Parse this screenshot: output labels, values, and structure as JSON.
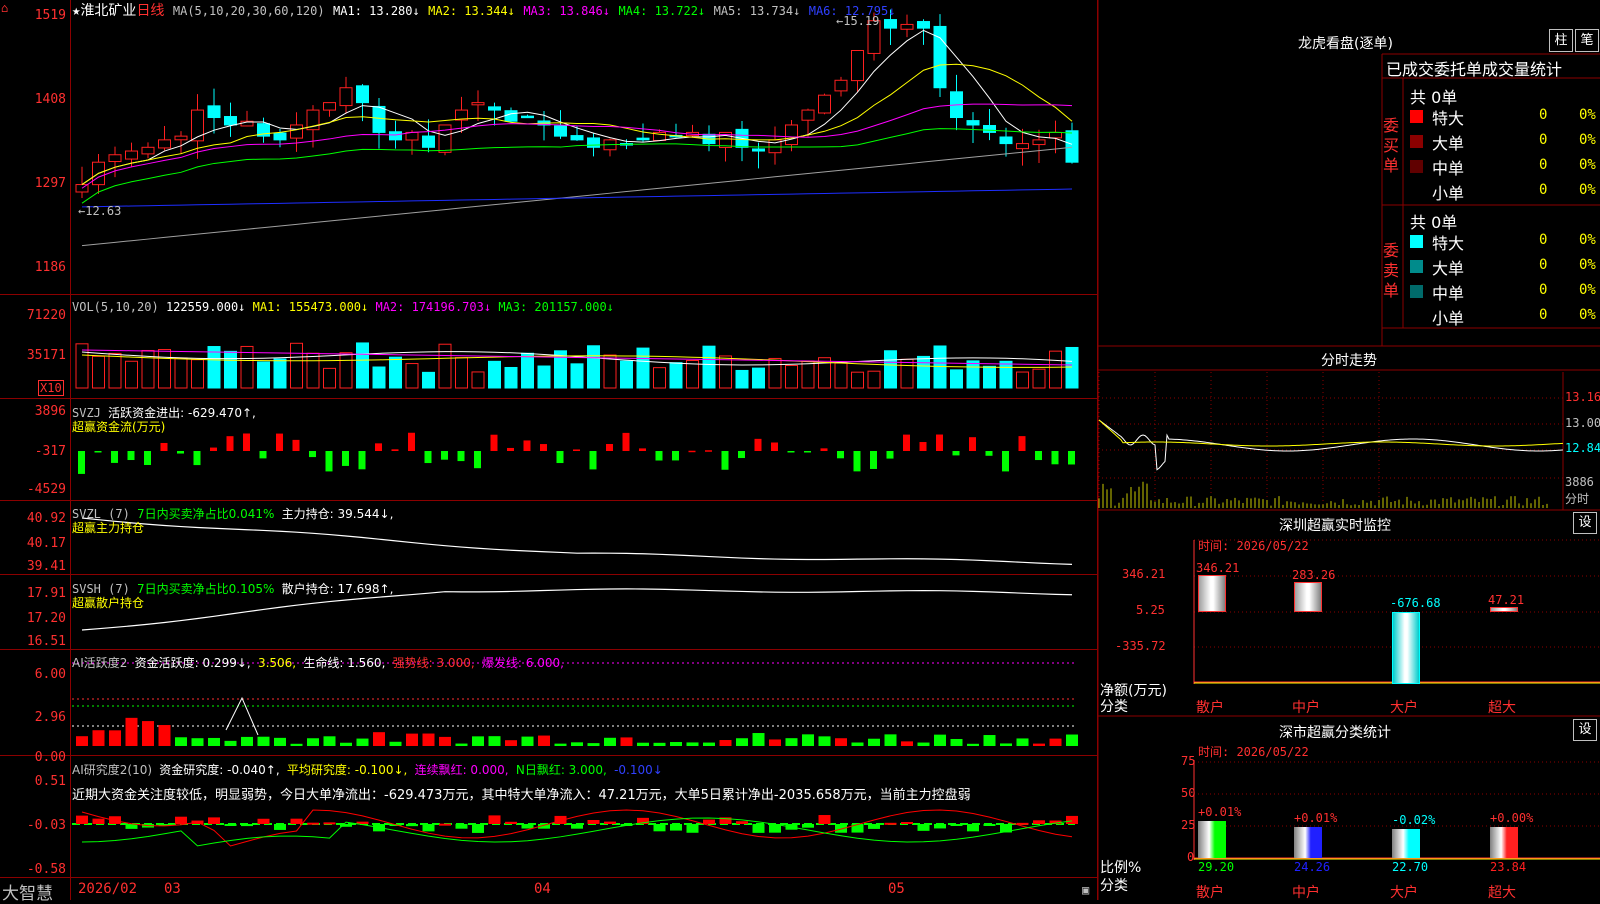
{
  "colors": {
    "up": "#ff2020",
    "down": "#00ffff",
    "vol_up": "#ff2020",
    "vol_down": "#00ffff",
    "green": "#00ff00",
    "red": "#ff0000",
    "yellow": "#ffff00",
    "white": "#ffffff",
    "magenta": "#ff00ff",
    "blue": "#1e2eff",
    "gray": "#a0a0a0",
    "grid": "#8b0000",
    "axis": "#ff3030"
  },
  "header": {
    "star": "★",
    "stock_name": "淮北矿业",
    "period": "日线",
    "ma_label": "MA(5,10,20,30,60,120)",
    "ma1": "MA1: 13.280↓",
    "ma2": "MA2: 13.344↓",
    "ma3": "MA3: 13.846↓",
    "ma4": "MA4: 13.722↓",
    "ma5": "MA5: 13.734↓",
    "ma6": "MA6: 12.795↓"
  },
  "price_axis": [
    "1519",
    "1408",
    "1297",
    "1186"
  ],
  "price_markers": {
    "high": "15.19",
    "low": "12.63"
  },
  "vol_panel": {
    "label": "VOL(5,10,20)",
    "value": "122559.000↓",
    "ma1": "MA1: 155473.000↓",
    "ma2": "MA2: 174196.703↓",
    "ma3": "MA3: 201157.000↓",
    "axis": [
      "71220",
      "35171"
    ],
    "unit": "X10"
  },
  "svzj_panel": {
    "label": "SVZJ",
    "desc": "活跃资金进出: -629.470↑,",
    "sub": "超赢资金流(万元)",
    "axis": [
      "3896",
      "-317",
      "-4529"
    ]
  },
  "svzl_panel": {
    "label": "SVZL (7)",
    "desc": "7日内买卖净占比0.041%",
    "hold": "主力持仓: 39.544↓,",
    "sub": "超赢主力持仓",
    "axis": [
      "40.92",
      "40.17",
      "39.41"
    ]
  },
  "svsh_panel": {
    "label": "SVSH (7)",
    "desc": "7日内买卖净占比0.105%",
    "hold": "散户持仓: 17.698↑,",
    "sub": "超赢散户持仓",
    "axis": [
      "17.91",
      "17.20",
      "16.51"
    ]
  },
  "ai1_panel": {
    "label": "AI活跃度2",
    "a": "资金活跃度: 0.299↓,",
    "b": "3.506,",
    "c": "生命线: 1.560,",
    "d": "强势线: 3.000,",
    "e": "爆发线: 6.000,",
    "axis": [
      "6.00",
      "2.96",
      "0.00"
    ]
  },
  "ai2_panel": {
    "label": "AI研究度2(10)",
    "a": "资金研究度: -0.040↑,",
    "b": "平均研究度: -0.100↓,",
    "c": "连续飘红: 0.000,",
    "d": "N日飘红: 3.000,",
    "e": "-0.100↓",
    "note": "近期大资金关注度较低，明显弱势，今日大单净流出：-629.473万元，其中特大单净流入：47.21万元，大单5日累计净出-2035.658万元，当前主力控盘弱",
    "axis": [
      "0.51",
      "-0.03",
      "-0.58"
    ]
  },
  "footer": {
    "brand": "大智慧",
    "dates": [
      "2026/02",
      "03",
      "04",
      "05"
    ]
  },
  "dragon": {
    "title": "龙虎看盘(逐单)",
    "btn1": "柱",
    "btn2": "笔",
    "col_header": "已成交委托单成交量统计",
    "buy": {
      "side": "委买单",
      "total": "共 0单",
      "rows": [
        {
          "name": "特大",
          "v": "0",
          "p": "0%",
          "c": "#ff0000"
        },
        {
          "name": "大单",
          "v": "0",
          "p": "0%",
          "c": "#8b0000"
        },
        {
          "name": "中单",
          "v": "0",
          "p": "0%",
          "c": "#600000"
        },
        {
          "name": "小单",
          "v": "0",
          "p": "0%",
          "c": "#000000"
        }
      ]
    },
    "sell": {
      "side": "委卖单",
      "total": "共 0单",
      "rows": [
        {
          "name": "特大",
          "v": "0",
          "p": "0%",
          "c": "#00ffff"
        },
        {
          "name": "大单",
          "v": "0",
          "p": "0%",
          "c": "#008b8b"
        },
        {
          "name": "中单",
          "v": "0",
          "p": "0%",
          "c": "#006a6a"
        },
        {
          "name": "小单",
          "v": "0",
          "p": "0%",
          "c": "#000000"
        }
      ]
    }
  },
  "intraday": {
    "title": "分时走势",
    "axis": [
      "13.16",
      "13.00",
      "12.84"
    ],
    "vol": "3886",
    "unit": "分时"
  },
  "monitor": {
    "title": "深圳超赢实时监控",
    "btn": "设",
    "time": "时间: 2026/05/22",
    "ylabel": "净额(万元)",
    "xcat": "分类",
    "axis": [
      "346.21",
      "5.25",
      "-335.72",
      "-676.68"
    ],
    "bars": [
      {
        "cat": "散户",
        "value": 346.21,
        "label": "346.21"
      },
      {
        "cat": "中户",
        "value": 283.26,
        "label": "283.26"
      },
      {
        "cat": "大户",
        "value": -676.68,
        "label": "-676.68"
      },
      {
        "cat": "超大",
        "value": 47.21,
        "label": "47.21"
      }
    ]
  },
  "classify": {
    "title": "深市超赢分类统计",
    "btn": "设",
    "time": "时间: 2026/05/22",
    "ylabel": "比例%",
    "xcat": "分类",
    "axis": [
      "75",
      "50",
      "25",
      "0"
    ],
    "bars": [
      {
        "cat": "散户",
        "value": 29.2,
        "label": "29.20",
        "chg": "+0.01%",
        "c": "#00ff00"
      },
      {
        "cat": "中户",
        "value": 24.26,
        "label": "24.26",
        "chg": "+0.01%",
        "c": "#2020ff"
      },
      {
        "cat": "大户",
        "value": 22.7,
        "label": "22.70",
        "chg": "-0.02%",
        "c": "#00ffff"
      },
      {
        "cat": "超大",
        "value": 23.84,
        "label": "23.84",
        "chg": "+0.00%",
        "c": "#ff2020"
      }
    ]
  }
}
